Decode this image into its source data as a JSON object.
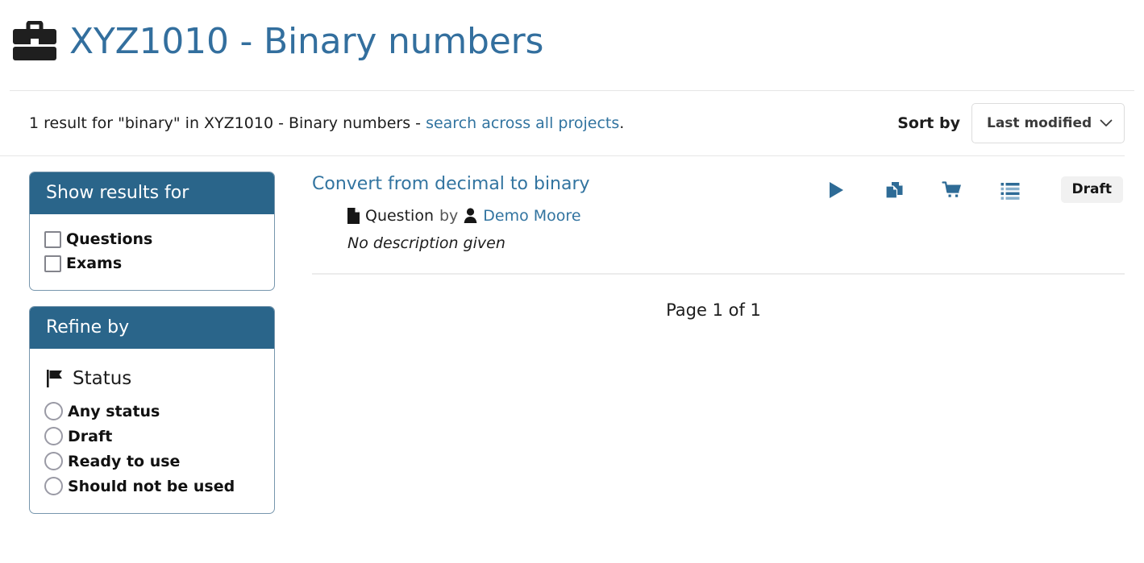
{
  "header": {
    "icon": "briefcase-icon",
    "title": "XYZ1010 - Binary numbers"
  },
  "results_bar": {
    "summary_prefix": "1 result for \"binary\" in XYZ1010 - Binary numbers - ",
    "summary_link": "search across all projects",
    "summary_suffix": ".",
    "sort_label": "Sort by",
    "sort_value": "Last modified",
    "sort_options": [
      "Last modified"
    ],
    "chevron_icon": "chevron-down-icon"
  },
  "sidebar": {
    "show_results": {
      "title": "Show results for",
      "options": [
        {
          "label": "Questions",
          "checked": false
        },
        {
          "label": "Exams",
          "checked": false
        }
      ]
    },
    "refine": {
      "title": "Refine by",
      "facets": [
        {
          "icon": "flag-icon",
          "title": "Status",
          "options": [
            {
              "label": "Any status",
              "selected": false
            },
            {
              "label": "Draft",
              "selected": false
            },
            {
              "label": "Ready to use",
              "selected": false
            },
            {
              "label": "Should not be used",
              "selected": false
            }
          ]
        }
      ]
    }
  },
  "main": {
    "results": [
      {
        "title": "Convert from decimal to binary",
        "type_icon": "document-icon",
        "type": "Question",
        "by": "by",
        "author_icon": "person-icon",
        "author": "Demo Moore",
        "description": "No description given",
        "status": "Draft",
        "actions": [
          {
            "name": "run-icon",
            "title": "Run"
          },
          {
            "name": "copy-icon",
            "title": "Copy"
          },
          {
            "name": "cart-icon",
            "title": "Add to basket"
          },
          {
            "name": "list-icon",
            "title": "Add to queue"
          }
        ]
      }
    ],
    "pager": "Page 1 of 1"
  },
  "colors": {
    "brand_blue": "#336f9e",
    "panel_header": "#2a658a",
    "link": "#3274a0",
    "icon_blue": "#2e6b96",
    "badge_bg": "#f1f1f1"
  }
}
